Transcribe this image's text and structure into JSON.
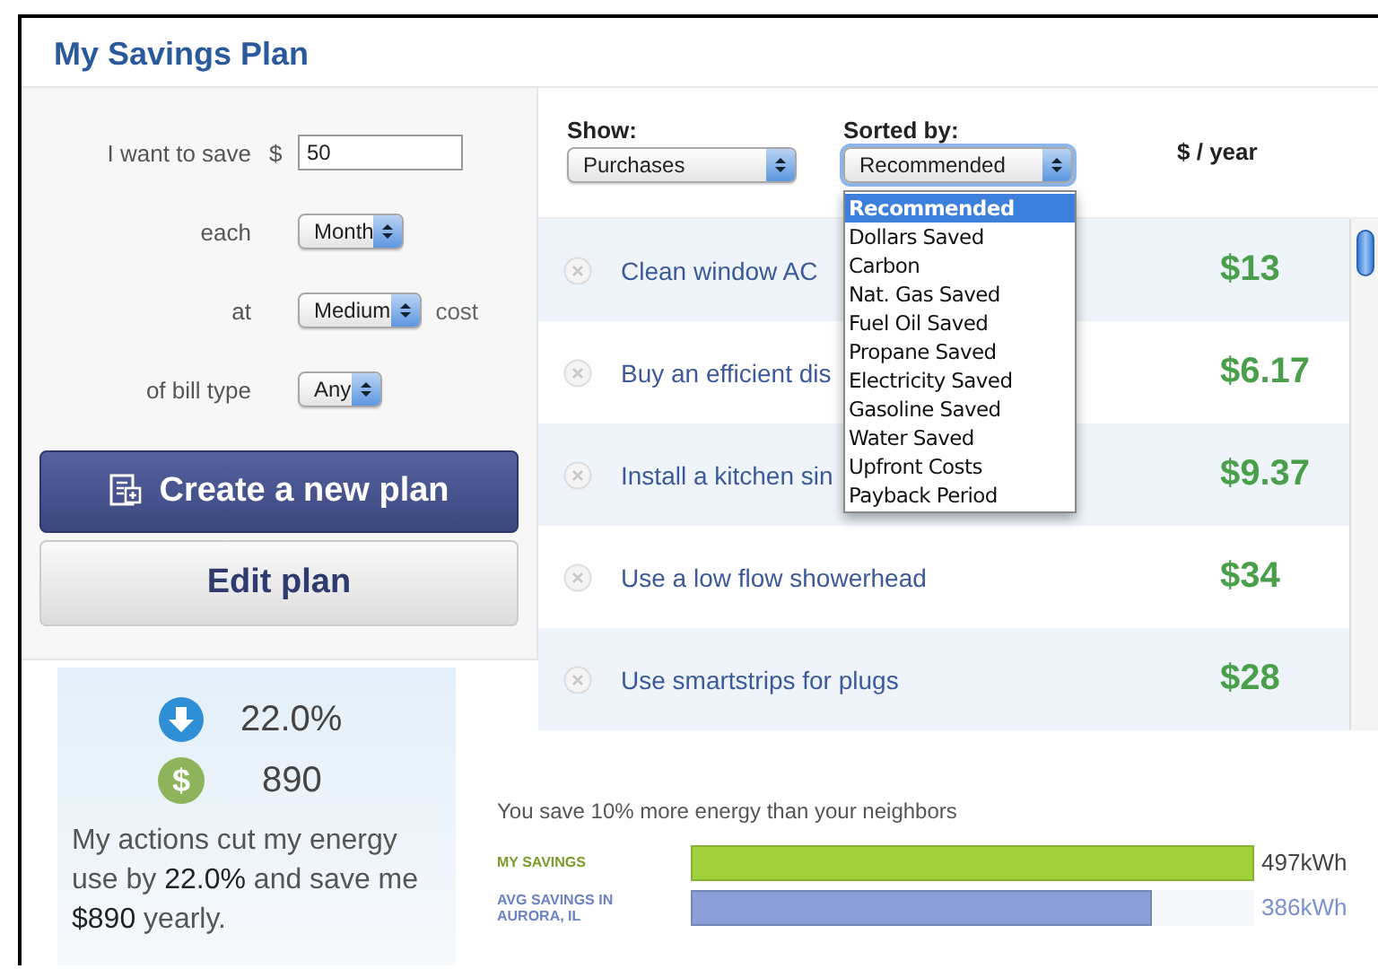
{
  "title": "My Savings Plan",
  "plan_form": {
    "fields": [
      {
        "kind": "amount",
        "label": "I want to save",
        "prefix": "$",
        "value": "50"
      },
      {
        "kind": "select",
        "label": "each",
        "value": "Month"
      },
      {
        "kind": "select",
        "label": "at",
        "value": "Medium",
        "suffix": "cost"
      },
      {
        "kind": "select",
        "label": "of bill type",
        "value": "Any"
      }
    ],
    "buttons": [
      {
        "kind": "primary",
        "label": "Create a new plan"
      },
      {
        "kind": "secondary",
        "label": "Edit plan"
      }
    ]
  },
  "summary": {
    "stats": [
      {
        "kind": "reduction",
        "value": "22.0%"
      },
      {
        "kind": "money",
        "symbol": "$",
        "value": "890"
      }
    ],
    "text": "My actions cut my energy use by **22.0%** and save me **$890** yearly."
  },
  "actions": {
    "show": {
      "label": "Show:",
      "value": "Purchases"
    },
    "sort": {
      "label": "Sorted by:",
      "value": "Recommended",
      "expanded": true,
      "options": [
        {
          "label": "Recommended",
          "selected": true
        },
        {
          "label": "Dollars Saved",
          "selected": false
        },
        {
          "label": "Carbon",
          "selected": false
        },
        {
          "label": "Nat. Gas Saved",
          "selected": false
        },
        {
          "label": "Fuel Oil Saved",
          "selected": false
        },
        {
          "label": "Propane Saved",
          "selected": false
        },
        {
          "label": "Electricity Saved",
          "selected": false
        },
        {
          "label": "Gasoline Saved",
          "selected": false
        },
        {
          "label": "Water Saved",
          "selected": false
        },
        {
          "label": "Upfront Costs",
          "selected": false
        },
        {
          "label": "Payback Period",
          "selected": false
        }
      ]
    },
    "value_header": "$ / year",
    "rows": [
      {
        "title": "Clean window AC",
        "amount": "$13"
      },
      {
        "title": "Buy an efficient dis",
        "amount": "$6.17"
      },
      {
        "title": "Install a kitchen sin",
        "amount": "$9.37"
      },
      {
        "title": "Use a low flow showerhead",
        "amount": "$34"
      },
      {
        "title": "Use smartstrips for plugs",
        "amount": "$28"
      }
    ]
  },
  "neighbors": {
    "caption": "You save 10% more energy than your neighbors",
    "bars": [
      {
        "kind": "mine",
        "label": "MY SAVINGS",
        "level": 1,
        "reading": "497kWh",
        "color": "#9fd03c"
      },
      {
        "kind": "average",
        "label": "AVG SAVINGS IN AURORA, IL",
        "level": 0.82,
        "reading": "386kWh",
        "color": "#8b9fd6"
      }
    ]
  }
}
